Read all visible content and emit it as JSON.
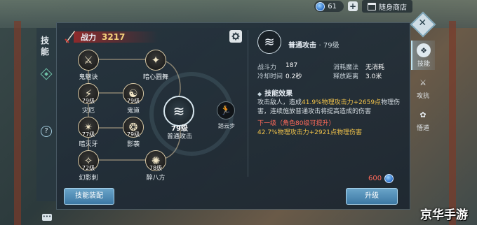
{
  "topbar": {
    "currency_value": "61",
    "shop_label": "随身商店"
  },
  "left_tab": {
    "title": "技能"
  },
  "power": {
    "label": "战力",
    "value": "3217"
  },
  "tree": {
    "nodes": [
      {
        "label": "鬼魅诀",
        "level": ""
      },
      {
        "label": "暗心圆舞",
        "level": ""
      },
      {
        "label": "灾厄",
        "level": "79级"
      },
      {
        "label": "鬼道",
        "level": "79级"
      },
      {
        "label": "暗灭牙",
        "level": "77级"
      },
      {
        "label": "影袭",
        "level": "79级"
      },
      {
        "label": "幻影刺",
        "level": "72级"
      },
      {
        "label": "醉八方",
        "level": "78级"
      }
    ],
    "main": {
      "label": "普通攻击",
      "level": "79级"
    },
    "side": {
      "label": "踏云步"
    }
  },
  "equip_button": "技能装配",
  "detail": {
    "name": "普通攻击",
    "level": "· 79级",
    "stats": [
      {
        "k": "战斗力",
        "v": "187",
        "k2": "消耗魔法",
        "v2": "无消耗"
      },
      {
        "k": "冷却时间",
        "v": "0.2秒",
        "k2": "释放距离",
        "v2": "3.0米"
      }
    ],
    "effect_title": "技能效果",
    "desc_pre": "攻击敌人，造成",
    "desc_hl1": "41.9%物理攻击力+2659点",
    "desc_mid": "物理伤害，连续施放普通攻击将提高造成的伤害",
    "next_title": "下一级（角色80级可提升）",
    "next_desc": "42.7%物理攻击力+2921点物理伤害",
    "cost": "600",
    "upgrade_button": "升级"
  },
  "side_tabs": [
    {
      "label": "技能",
      "icon": "skill-icon"
    },
    {
      "label": "攻抗",
      "icon": "attack-resist-icon"
    },
    {
      "label": "悟道",
      "icon": "enlighten-icon"
    }
  ],
  "watermark": "京华手游",
  "colors": {
    "accent": "#f0c24a",
    "warning": "#ff6a5a",
    "button": "#3c78a4"
  }
}
